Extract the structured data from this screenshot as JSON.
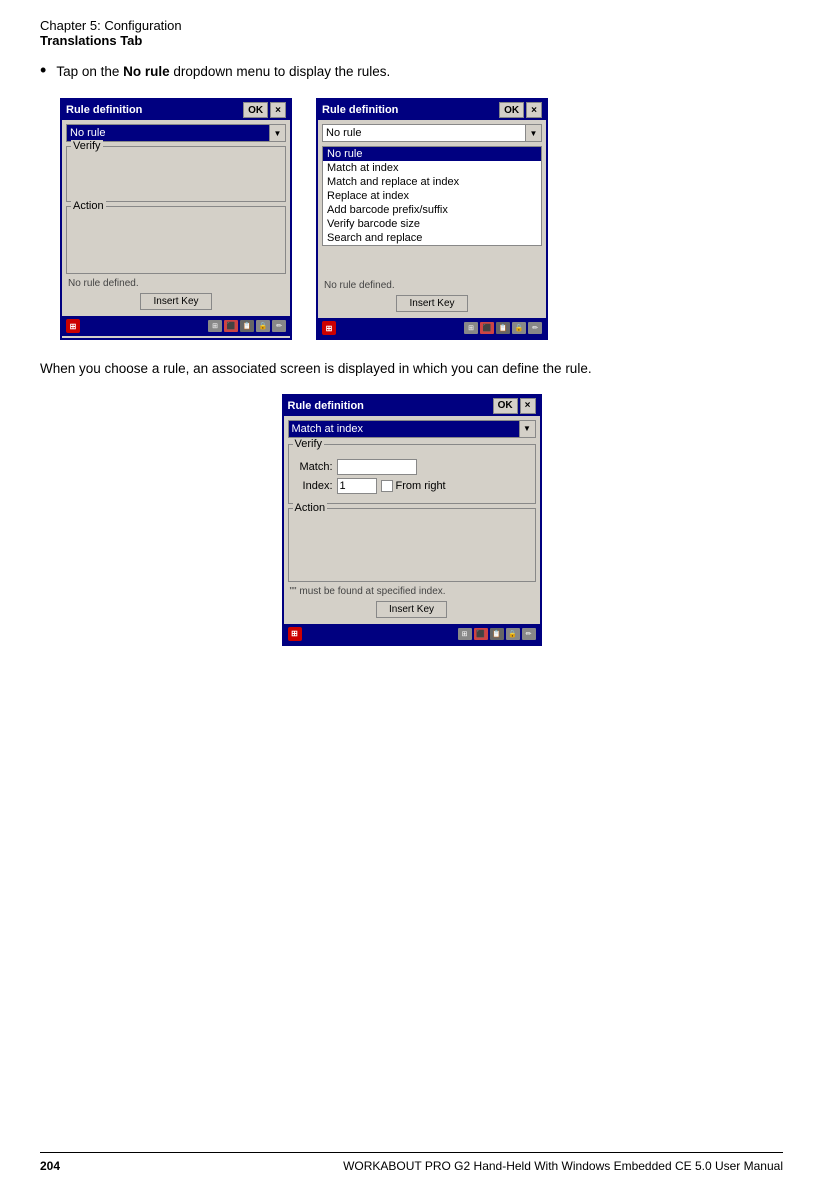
{
  "header": {
    "chapter": "Chapter  5:  Configuration",
    "tab": "Translations Tab"
  },
  "bullet_section": {
    "bullet_intro": "Tap on the ",
    "bullet_bold": "No rule",
    "bullet_rest": " dropdown menu to display the rules."
  },
  "dialog1": {
    "title": "Rule definition",
    "ok_label": "OK",
    "close_label": "×",
    "dropdown_value": "No rule",
    "verify_label": "Verify",
    "action_label": "Action",
    "status_text": "No rule defined.",
    "insert_key": "Insert Key"
  },
  "dialog2": {
    "title": "Rule definition",
    "ok_label": "OK",
    "close_label": "×",
    "dropdown_value": "No rule",
    "menu_items": [
      {
        "label": "No rule",
        "selected": true
      },
      {
        "label": "Match at index",
        "selected": false
      },
      {
        "label": "Match and replace at index",
        "selected": false
      },
      {
        "label": "Replace at index",
        "selected": false
      },
      {
        "label": "Add barcode prefix/suffix",
        "selected": false
      },
      {
        "label": "Verify barcode size",
        "selected": false
      },
      {
        "label": "Search and replace",
        "selected": false
      }
    ],
    "status_text": "No rule defined.",
    "insert_key": "Insert Key"
  },
  "paragraph": {
    "text": "When you choose a rule, an associated screen is displayed in which you can define the rule."
  },
  "dialog3": {
    "title": "Rule definition",
    "ok_label": "OK",
    "close_label": "×",
    "dropdown_value": "Match at index",
    "verify_label": "Verify",
    "match_label": "Match:",
    "index_label": "Index:",
    "index_value": "1",
    "from_right_label": "From right",
    "action_label": "Action",
    "status_text": "\"\" must be found at specified index.",
    "insert_key": "Insert Key"
  },
  "footer": {
    "page_number": "204",
    "text": "WORKABOUT PRO G2 Hand-Held With Windows Embedded CE 5.0 User Manual"
  }
}
